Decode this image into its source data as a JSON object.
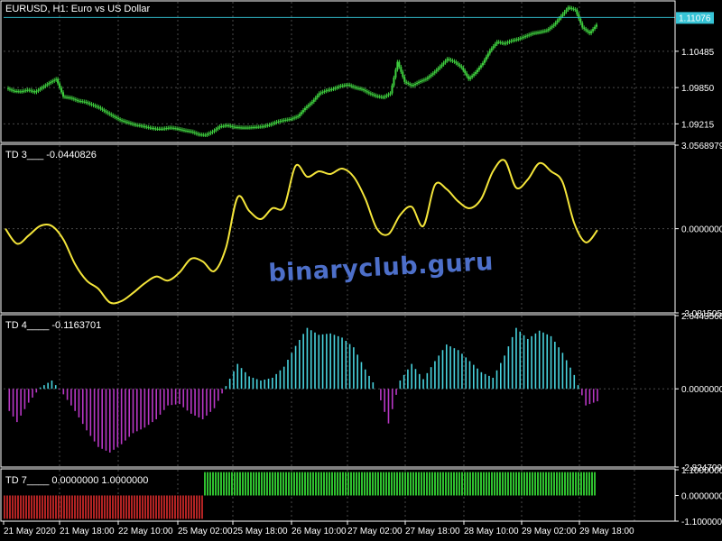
{
  "chart_data": [
    {
      "type": "line",
      "subtype": "candlestick",
      "title": "EURUSD, H1:  Euro vs US Dollar",
      "x_labels": [
        "21 May 2020",
        "21 May 18:00",
        "22 May 10:00",
        "25 May 02:00",
        "25 May 18:00",
        "26 May 10:00",
        "27 May 02:00",
        "27 May 18:00",
        "28 May 10:00",
        "29 May 02:00",
        "29 May 18:00"
      ],
      "ylim": [
        1.0889,
        1.1135
      ],
      "y_ticks": [
        "1.10485",
        "1.09850",
        "1.09215"
      ],
      "current_price": "1.11076",
      "current_value": 1.11076,
      "series": [
        {
          "values": [
            1.0984,
            1.0979,
            1.0978,
            1.0981,
            1.0977,
            1.0985,
            1.0993,
            1.1,
            1.0969,
            1.0967,
            1.0962,
            1.096,
            1.0955,
            1.095,
            1.0942,
            1.0935,
            1.0928,
            1.0924,
            1.092,
            1.0918,
            1.0915,
            1.0913,
            1.0913,
            1.0915,
            1.0913,
            1.091,
            1.0908,
            1.0903,
            1.0902,
            1.0908,
            1.0917,
            1.0919,
            1.0916,
            1.0915,
            1.0915,
            1.0916,
            1.0917,
            1.092,
            1.0925,
            1.0928,
            1.093,
            1.0935,
            1.0949,
            1.096,
            1.0975,
            1.098,
            1.0983,
            1.0988,
            1.099,
            1.0985,
            1.0982,
            1.0975,
            1.097,
            1.0968,
            1.0975,
            1.103,
            1.0995,
            1.0988,
            1.0995,
            1.1,
            1.101,
            1.1022,
            1.1035,
            1.103,
            1.102,
            1.1,
            1.1012,
            1.1028,
            1.105,
            1.1065,
            1.1062,
            1.1067,
            1.107,
            1.1075,
            1.108,
            1.1082,
            1.1085,
            1.1095,
            1.111,
            1.1125,
            1.1121,
            1.109,
            1.108,
            1.1095
          ]
        }
      ]
    },
    {
      "type": "line",
      "title": "TD 3___  -0.0440826",
      "ylim": [
        -3.0815054,
        3.0568979
      ],
      "y_ticks": [
        "3.0568979",
        "0.0000000",
        "-3.0815054"
      ],
      "series": [
        {
          "name": "TD 3",
          "values": [
            0.0,
            -0.55,
            -0.25,
            0.1,
            0.1,
            -0.4,
            -1.3,
            -1.9,
            -2.2,
            -2.7,
            -2.65,
            -2.35,
            -2.0,
            -1.75,
            -1.9,
            -1.6,
            -1.1,
            -1.2,
            -1.55,
            -0.7,
            1.15,
            0.65,
            0.35,
            0.75,
            0.8,
            2.3,
            1.9,
            2.1,
            2.0,
            2.2,
            1.9,
            1.1,
            0.0,
            -0.2,
            0.5,
            0.8,
            0.1,
            1.6,
            1.45,
            1.0,
            0.75,
            1.1,
            2.1,
            2.5,
            1.5,
            1.8,
            2.4,
            2.1,
            1.7,
            0.2,
            -0.5,
            -0.05
          ]
        }
      ]
    },
    {
      "type": "bar",
      "title": "TD 4____  -0.1163701",
      "ylim": [
        -2.8247092,
        2.6443568
      ],
      "y_ticks": [
        "2.6443568",
        "0.0000000",
        "-2.8247092"
      ],
      "series": [
        {
          "name": "TD 4",
          "values": [
            -0.6,
            -1.2,
            -0.5,
            0.05,
            0.3,
            -0.2,
            -0.8,
            -1.5,
            -2.1,
            -2.3,
            -2.0,
            -1.6,
            -1.4,
            -1.1,
            -0.6,
            -0.55,
            -0.9,
            -1.1,
            -0.7,
            0.1,
            0.9,
            0.45,
            0.3,
            0.4,
            0.8,
            1.55,
            2.2,
            1.95,
            2.0,
            1.85,
            1.5,
            0.7,
            0.0,
            -1.25,
            0.3,
            0.9,
            0.35,
            1.0,
            1.6,
            1.4,
            1.0,
            0.6,
            0.4,
            1.2,
            2.2,
            1.8,
            2.1,
            1.9,
            1.3,
            0.5,
            -0.6,
            -0.45
          ]
        }
      ]
    },
    {
      "type": "bar",
      "title": "TD 7____  0.0000000  1.0000000",
      "ylim": [
        -1.1,
        1.1
      ],
      "y_ticks": [
        "1.1000000",
        "0.0000000",
        "-1.1000000"
      ],
      "switch_fraction": 0.335,
      "series": [
        {
          "name": "TD 7",
          "values": [
            -1,
            1
          ]
        }
      ]
    }
  ],
  "watermark": "binaryclub.guru",
  "colors": {
    "background": "#000000",
    "grid": "#4a4a4a",
    "frame": "#ffffff",
    "candle": "#3fd13f",
    "price_line": "#2fb7c7",
    "price_label_bg": "#37c4d6",
    "td3_line": "#f4e53a",
    "td4_up": "#48d2dd",
    "td4_down": "#b837c5",
    "td7_up": "#2fc02f",
    "td7_down": "#b22323",
    "watermark": "#4d6fc9"
  }
}
